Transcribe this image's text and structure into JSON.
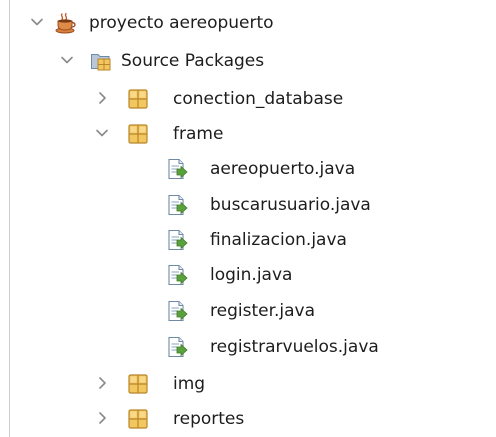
{
  "project_tree": {
    "project": {
      "label": "proyecto aereopuerto",
      "icon": "coffee-cup-project-icon",
      "expanded": true
    },
    "source_packages": {
      "label": "Source Packages",
      "icon": "source-folder-icon",
      "expanded": true
    },
    "packages": [
      {
        "label": "conection_database",
        "icon": "package-icon",
        "expanded": false
      },
      {
        "label": "frame",
        "icon": "package-icon",
        "expanded": true,
        "files": [
          {
            "label": "aereopuerto.java",
            "icon": "java-file-icon"
          },
          {
            "label": "buscarusuario.java",
            "icon": "java-file-icon"
          },
          {
            "label": "finalizacion.java",
            "icon": "java-file-icon"
          },
          {
            "label": "login.java",
            "icon": "java-file-icon"
          },
          {
            "label": "register.java",
            "icon": "java-file-icon"
          },
          {
            "label": "registrarvuelos.java",
            "icon": "java-file-icon"
          }
        ]
      },
      {
        "label": "img",
        "icon": "package-icon",
        "expanded": false
      },
      {
        "label": "reportes",
        "icon": "package-icon",
        "expanded": false
      }
    ]
  },
  "colors": {
    "package": "#e6b34a",
    "java_file": "#5aa03c",
    "toggle": "#8a8a8a"
  }
}
